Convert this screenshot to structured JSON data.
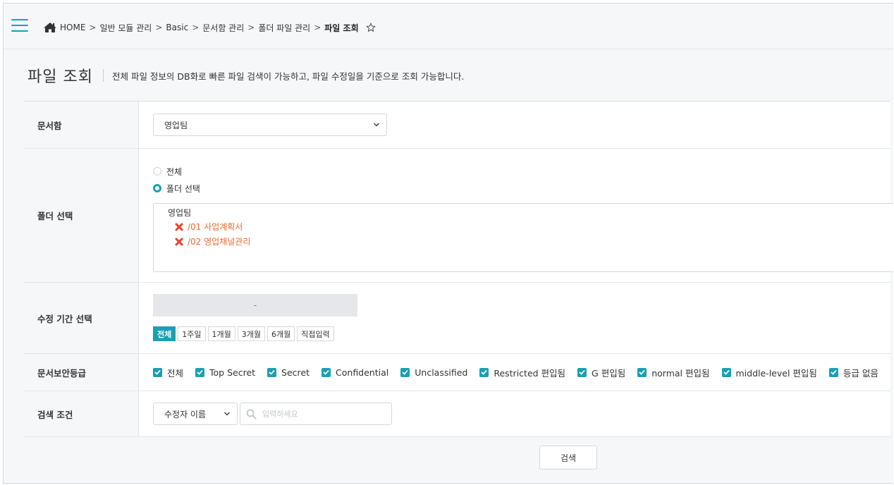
{
  "breadcrumb": {
    "items": [
      "HOME",
      "일반 모듈 관리",
      "Basic",
      "문서함 관리",
      "폴더 파일 관리"
    ],
    "current": "파일 조회",
    "separator": ">"
  },
  "page": {
    "title": "파일 조회",
    "description": "전체 파일 정보의 DB화로 빠른 파일 검색이 가능하고, 파일 수정일을 기준으로 조회 가능합니다."
  },
  "form": {
    "docbox": {
      "label": "문서함",
      "selected": "영업팀"
    },
    "folder": {
      "label": "폴더 선택",
      "radio_all": "전체",
      "radio_select": "폴더 선택",
      "selected_option": "폴더 선택",
      "root": "영업팀",
      "items": [
        "/01 사업계획서",
        "/02 영업채널관리"
      ]
    },
    "period": {
      "label": "수정 기간 선택",
      "range_text": "-",
      "buttons": [
        "전체",
        "1주일",
        "1개월",
        "3개월",
        "6개월",
        "직접입력"
      ],
      "active": "전체"
    },
    "security": {
      "label": "문서보안등급",
      "options": [
        "전체",
        "Top Secret",
        "Secret",
        "Confidential",
        "Unclassified",
        "Restricted 편입됨",
        "G 편입됨",
        "normal 편입됨",
        "middle-level 편입됨",
        "등급 없음"
      ]
    },
    "search": {
      "label": "검색 조건",
      "field_selected": "수정자 이름",
      "placeholder": "입력하세요"
    }
  },
  "actions": {
    "search_label": "검색"
  },
  "colors": {
    "accent": "#1aa0b4",
    "folder_item": "#f06a2a",
    "remove_icon": "#e8432e"
  },
  "icons": {
    "menu": "hamburger-icon",
    "home": "home-icon",
    "favorite": "star-outline-icon",
    "remove": "close-x-icon",
    "dropdown": "chevron-down-icon",
    "search": "search-icon",
    "check": "checkmark-icon"
  }
}
